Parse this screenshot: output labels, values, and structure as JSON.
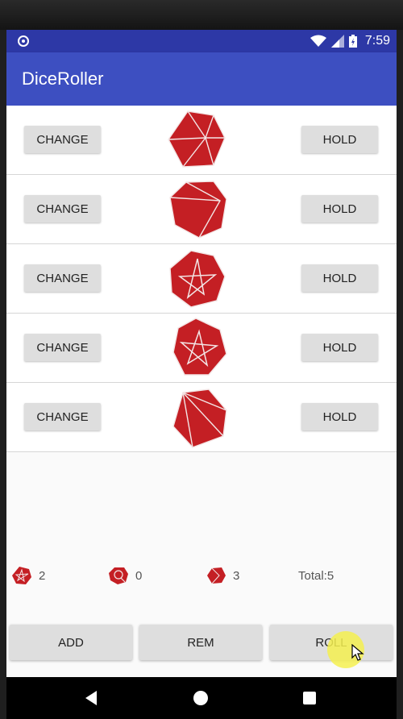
{
  "status_bar": {
    "time": "7:59"
  },
  "app": {
    "title": "DiceRoller"
  },
  "dice_rows": [
    {
      "change_label": "CHANGE",
      "hold_label": "HOLD",
      "die_icon": "d20-die-icon"
    },
    {
      "change_label": "CHANGE",
      "hold_label": "HOLD",
      "die_icon": "d10-die-icon"
    },
    {
      "change_label": "CHANGE",
      "hold_label": "HOLD",
      "die_icon": "d12-pentagram-die-icon"
    },
    {
      "change_label": "CHANGE",
      "hold_label": "HOLD",
      "die_icon": "d12-pentagram-die-icon"
    },
    {
      "change_label": "CHANGE",
      "hold_label": "HOLD",
      "die_icon": "d20-die-icon"
    }
  ],
  "summary": {
    "counts": [
      {
        "icon": "d12-die-icon",
        "count": "2"
      },
      {
        "icon": "d10-die-icon",
        "count": "0"
      },
      {
        "icon": "d20-die-icon",
        "count": "3"
      }
    ],
    "total": "Total:5"
  },
  "actions": {
    "add_label": "ADD",
    "rem_label": "REM",
    "roll_label": "ROLL"
  },
  "colors": {
    "appbar": "#3d4fc1",
    "statusbar": "#2d38a6",
    "die_red": "#c41f24"
  }
}
